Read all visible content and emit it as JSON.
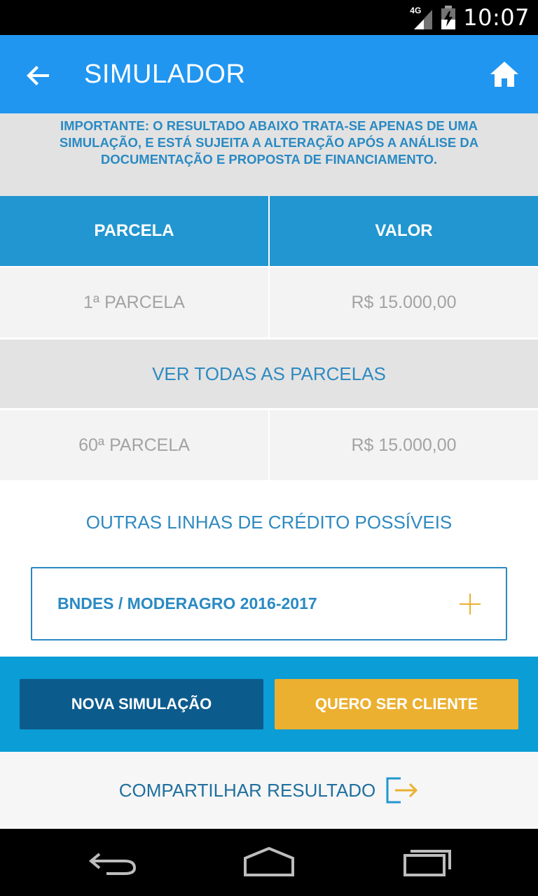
{
  "status_bar": {
    "network": "4G",
    "time": "10:07"
  },
  "app_bar": {
    "title": "SIMULADOR",
    "back_icon": "arrow-left-icon",
    "home_icon": "home-icon"
  },
  "notice": "IMPORTANTE: O RESULTADO ABAIXO TRATA-SE APENAS DE UMA SIMULAÇÃO, E ESTÁ SUJEITA A ALTERAÇÃO APÓS A ANÁLISE DA DOCUMENTAÇÃO E PROPOSTA DE FINANCIAMENTO.",
  "table": {
    "headers": [
      "PARCELA",
      "VALOR"
    ],
    "rows": [
      [
        "1ª PARCELA",
        "R$ 15.000,00"
      ],
      [
        "60ª PARCELA",
        "R$ 15.000,00"
      ]
    ],
    "see_all_label": "VER TODAS AS PARCELAS"
  },
  "other_credit": {
    "title": "OUTRAS LINHAS DE CRÉDITO POSSÍVEIS",
    "items": [
      {
        "label": "BNDES / MODERAGRO 2016-2017",
        "icon": "plus-icon"
      }
    ]
  },
  "actions": {
    "new_simulation": "NOVA SIMULAÇÃO",
    "become_client": "QUERO SER CLIENTE"
  },
  "share": {
    "label": "COMPARTILHAR RESULTADO",
    "icon": "share-export-icon"
  },
  "colors": {
    "app_bar": "#2196f0",
    "table_header": "#2196d0",
    "accent_text": "#2a8ac3",
    "action_band": "#0a9dd6",
    "button_primary": "#0c5b8d",
    "button_secondary": "#ebb030"
  }
}
